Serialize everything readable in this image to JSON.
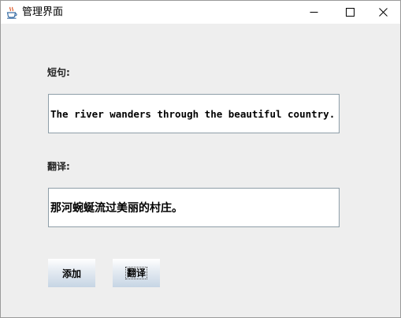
{
  "window": {
    "title": "管理界面",
    "app_icon": "java-coffee-cup-icon",
    "controls": [
      "minimize-icon",
      "maximize-icon",
      "close-icon"
    ]
  },
  "form": {
    "sentence_label": "短句:",
    "sentence_value": "The river wanders through the beautiful country.",
    "translation_label": "翻译:",
    "translation_value": "那河蜿蜒流过美丽的村庄。"
  },
  "buttons": {
    "add_label": "添加",
    "translate_label": "翻译"
  },
  "colors": {
    "window_background": "#eeeeee",
    "field_border": "#8e9ea8",
    "button_gradient_top": "#ffffff",
    "button_gradient_bottom": "#c6d5e4"
  }
}
